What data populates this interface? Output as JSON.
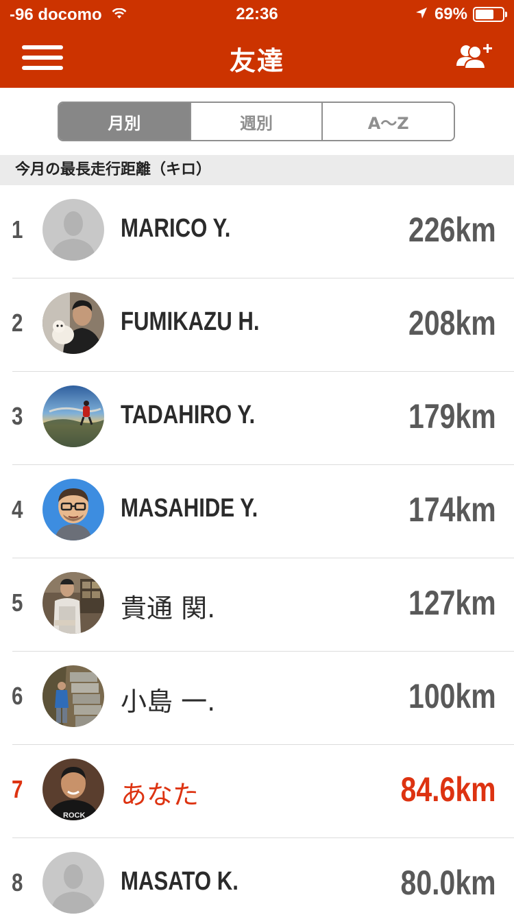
{
  "status_bar": {
    "carrier": "-96 docomo",
    "time": "22:36",
    "battery": "69%",
    "battery_level": 0.69,
    "icons": [
      "wifi-icon",
      "location-arrow-icon",
      "battery-icon"
    ]
  },
  "nav": {
    "title": "友達",
    "menu_icon": "hamburger-menu-icon",
    "add_icon": "add-friend-icon"
  },
  "tabs": [
    {
      "label": "月別",
      "active": true
    },
    {
      "label": "週別",
      "active": false
    },
    {
      "label": "A〜Z",
      "active": false
    }
  ],
  "section": {
    "title": "今月の最長走行距離（キロ）"
  },
  "ranking": [
    {
      "rank": "1",
      "name": "MARICO Y.",
      "distance": "226km",
      "avatar": "default-avatar"
    },
    {
      "rank": "2",
      "name": "FUMIKAZU H.",
      "distance": "208km",
      "avatar": "photo-man-with-dog"
    },
    {
      "rank": "3",
      "name": "TADAHIRO Y.",
      "distance": "179km",
      "avatar": "photo-runner-sunset"
    },
    {
      "rank": "4",
      "name": "MASAHIDE Y.",
      "distance": "174km",
      "avatar": "cartoon-man-glasses"
    },
    {
      "rank": "5",
      "name": "貴通 関.",
      "distance": "127km",
      "avatar": "photo-man-apron"
    },
    {
      "rank": "6",
      "name": "小島 一.",
      "distance": "100km",
      "avatar": "photo-man-stone-stairs"
    },
    {
      "rank": "7",
      "name": "あなた",
      "distance": "84.6km",
      "avatar": "photo-man-black-hoodie",
      "is_self": true
    },
    {
      "rank": "8",
      "name": "MASATO K.",
      "distance": "80.0km",
      "avatar": "default-avatar"
    }
  ],
  "colors": {
    "header": "#cc3300",
    "highlight": "#dd3311",
    "text": "#2b2b2b",
    "muted": "#595959"
  }
}
